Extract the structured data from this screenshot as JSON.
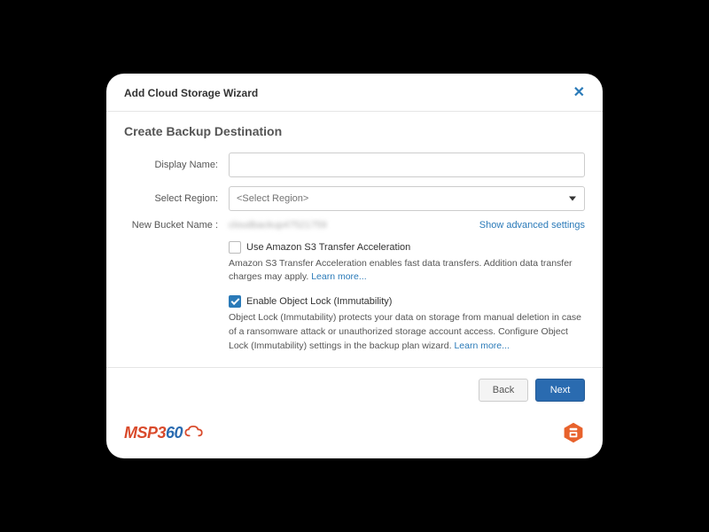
{
  "header": {
    "title": "Add Cloud Storage Wizard"
  },
  "section": {
    "title": "Create Backup Destination"
  },
  "form": {
    "display_name_label": "Display Name:",
    "display_name_value": "",
    "select_region_label": "Select Region:",
    "select_region_placeholder": "<Select Region>",
    "new_bucket_label": "New Bucket Name :",
    "new_bucket_value": "cloudbackup47521759",
    "advanced_link": "Show advanced settings"
  },
  "s3accel": {
    "checked": false,
    "label": "Use Amazon S3 Transfer Acceleration",
    "help": "Amazon S3 Transfer Acceleration enables fast data transfers. Addition data transfer charges may apply. ",
    "learn_more": "Learn more..."
  },
  "objlock": {
    "checked": true,
    "label": "Enable Object Lock (Immutability)",
    "help": "Object Lock (Immutability) protects your data on storage from manual deletion in case of a ransomware attack or unauthorized storage account access. Configure Object Lock (Immutability) settings in the backup plan wizard. ",
    "learn_more": "Learn more..."
  },
  "footer": {
    "back": "Back",
    "next": "Next"
  },
  "brand": {
    "msp": "MSP",
    "three": "3",
    "six": "6",
    "zero": "0"
  }
}
